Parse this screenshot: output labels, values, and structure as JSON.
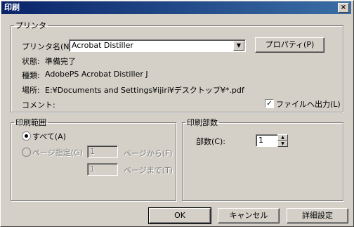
{
  "window": {
    "title": "印刷",
    "close_glyph": "×"
  },
  "printer": {
    "group_label": "プリンタ",
    "name_label": "プリンタ名(N):",
    "selected": "Acrobat Distiller",
    "properties_button": "プロパティ(P)",
    "status_label": "状態:",
    "status_value": "準備完了",
    "type_label": "種類:",
    "type_value": "AdobePS Acrobat Distiller J",
    "location_label": "場所:",
    "location_value": "E:¥Documents and Settings¥ijiri¥デスクトップ¥*.pdf",
    "comment_label": "コメント:",
    "print_to_file_label": "ファイルへ出力(L)",
    "print_to_file_checked": true
  },
  "range": {
    "group_label": "印刷範囲",
    "all_label": "すべて(A)",
    "pages_label": "ページ指定(G)",
    "from_value": "1",
    "from_label": "ページから(F)",
    "to_value": "1",
    "to_label": "ページまで(T)"
  },
  "copies": {
    "group_label": "印刷部数",
    "count_label": "部数(C):",
    "count_value": "1"
  },
  "buttons": {
    "ok": "OK",
    "cancel": "キャンセル",
    "advanced": "詳細設定"
  }
}
